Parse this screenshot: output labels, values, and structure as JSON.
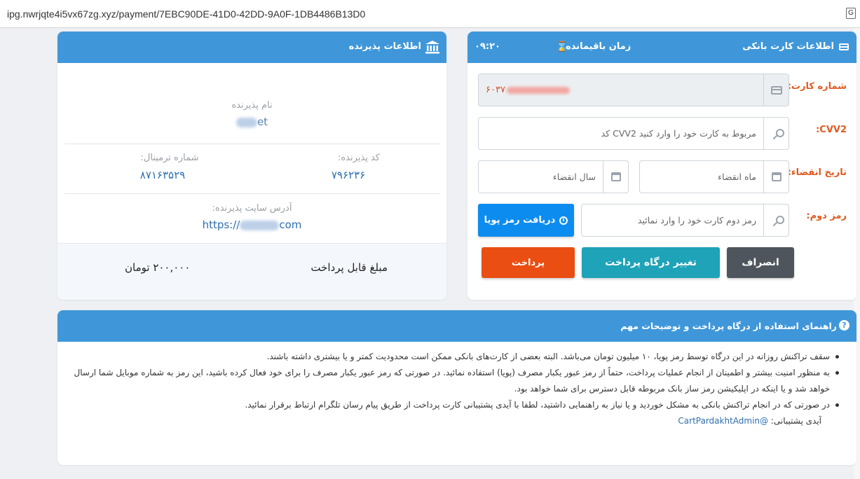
{
  "browser": {
    "url": "ipg.nwrjqte4i5vx67zg.xyz/payment/7EBC90DE-41D0-42DD-9A0F-1DB4486B13D0",
    "translate_icon_label": "G"
  },
  "merchant": {
    "header_title": "اطلاعات پذیرنده",
    "name_label": "نام پذیرنده",
    "name_value": "et",
    "code_label": "کد پذیرنده:",
    "code_value": "۷۹۶۲۳۶",
    "terminal_label": "شماره ترمینال:",
    "terminal_value": "۸۷۱۶۳۵۲۹",
    "site_label": "آدرس سایت پذیرنده:",
    "site_value_prefix": "https://",
    "site_value_suffix": "com",
    "amount_label": "مبلغ قابل پرداخت",
    "amount_value": "۲۰۰,۰۰۰ تومان"
  },
  "card_form": {
    "header_title": "اطلاعات کارت بانکی",
    "timer_label": "زمان باقیمانده",
    "timer_value": "۰۹:۲۰",
    "card_number_label": "شماره کارت:",
    "card_number_value": "۶۰۳۷",
    "cvv2_label": "CVV2:",
    "cvv2_placeholder": "مربوط به کارت خود را وارد کنید CVV2 کد",
    "expiry_label": "تاریخ انقضاء:",
    "month_placeholder": "ماه انقضاء",
    "year_placeholder": "سال انقضاء",
    "pin2_label": "رمز دوم:",
    "pin2_placeholder": "رمز دوم کارت خود را وارد نمائید",
    "otp_button": "دریافت رمز پویا",
    "pay_button": "پرداخت",
    "change_gateway_button": "تغییر درگاه پرداخت",
    "cancel_button": "انصراف"
  },
  "guide": {
    "header_title": "راهنمای استفاده از درگاه پرداخت و توضیحات مهم",
    "items": [
      "سقف تراکنش روزانه در این درگاه توسط رمز پویا، ۱۰ میلیون تومان می‌باشد. البته بعضی از کارت‌های بانکی ممکن است محدودیت کمتر و یا بیشتری داشته باشند.",
      "به منظور امنیت بیشتر و اطمینان از انجام عملیات پرداخت، حتماً از رمز عبور یکبار مصرف (پویا) استفاده نمائید. در صورتی که رمز عبور یکبار مصرف را برای خود فعال کرده باشید، این رمز به شماره موبایل شما ارسال خواهد شد و یا اینکه در اپلیکیشن رمز ساز بانک مربوطه قابل دسترس برای شما خواهد بود.",
      "در صورتی که در انجام تراکنش بانکی به مشکل خوردید و یا نیاز به راهنمایی داشتید، لطفا با آیدی پشتیبانی کارت پرداخت از طریق پیام رسان تلگرام ارتباط برقرار نمائید."
    ],
    "support_label": "آیدی پشتیبانی:",
    "support_handle": "@CartPardakhtAdmin"
  },
  "colors": {
    "header_blue": "#3f97d9",
    "label_orange": "#e05a20",
    "pay_orange": "#ea4e12",
    "otp_blue": "#0d8cf0",
    "change_teal": "#1fa3b8",
    "cancel_gray": "#4e555c"
  }
}
